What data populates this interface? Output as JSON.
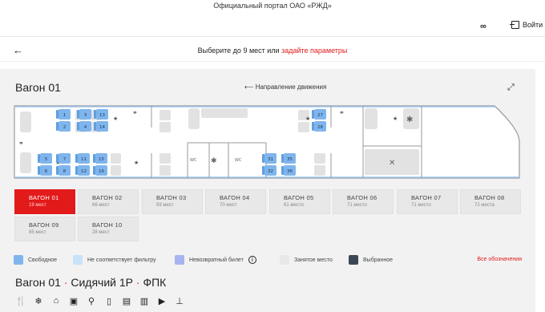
{
  "header": {
    "portal_title": "Официальный портал ОАО «РЖД»",
    "accessibility_icon": "glasses-icon",
    "login_label": "Войти"
  },
  "selection": {
    "text": "Выберите до 9 мест или ",
    "link": "задайте параметры"
  },
  "car": {
    "title": "Вагон 01",
    "direction_label": "Направление движения",
    "seats_top": [
      "1",
      "2",
      "3",
      "4",
      "13",
      "14",
      "27",
      "28"
    ],
    "seats_bottom": [
      "5",
      "6",
      "7",
      "8",
      "11",
      "12",
      "15",
      "16",
      "31",
      "32",
      "35",
      "36"
    ],
    "wc_labels": [
      "WC",
      "WC"
    ]
  },
  "tabs": [
    {
      "name": "ВАГОН 01",
      "seats": "19 мест"
    },
    {
      "name": "ВАГОН 02",
      "seats": "66 мест"
    },
    {
      "name": "ВАГОН 03",
      "seats": "59 мест"
    },
    {
      "name": "ВАГОН 04",
      "seats": "70 мест"
    },
    {
      "name": "ВАГОН 05",
      "seats": "61 место"
    },
    {
      "name": "ВАГОН 06",
      "seats": "71 место"
    },
    {
      "name": "ВАГОН 07",
      "seats": "71 место"
    },
    {
      "name": "ВАГОН 08",
      "seats": "72 места"
    },
    {
      "name": "ВАГОН 09",
      "seats": "85 мест"
    },
    {
      "name": "ВАГОН 10",
      "seats": "28 мест"
    }
  ],
  "legend": {
    "items": [
      {
        "label": "Свободное",
        "color": "#7fb5ec"
      },
      {
        "label": "Не соответствует фильтру",
        "color": "#c9e2f8"
      },
      {
        "label": "Невозвратный билет",
        "color": "#a7b4f0"
      },
      {
        "label": "Занятое место",
        "color": "#e8e8e8"
      },
      {
        "label": "Выбранное",
        "color": "#3b4754"
      }
    ],
    "all_label": "Все обозначения"
  },
  "subtitle": {
    "car": "Вагон 01",
    "class": "Сидячий 1Р",
    "carrier": "ФПК"
  }
}
